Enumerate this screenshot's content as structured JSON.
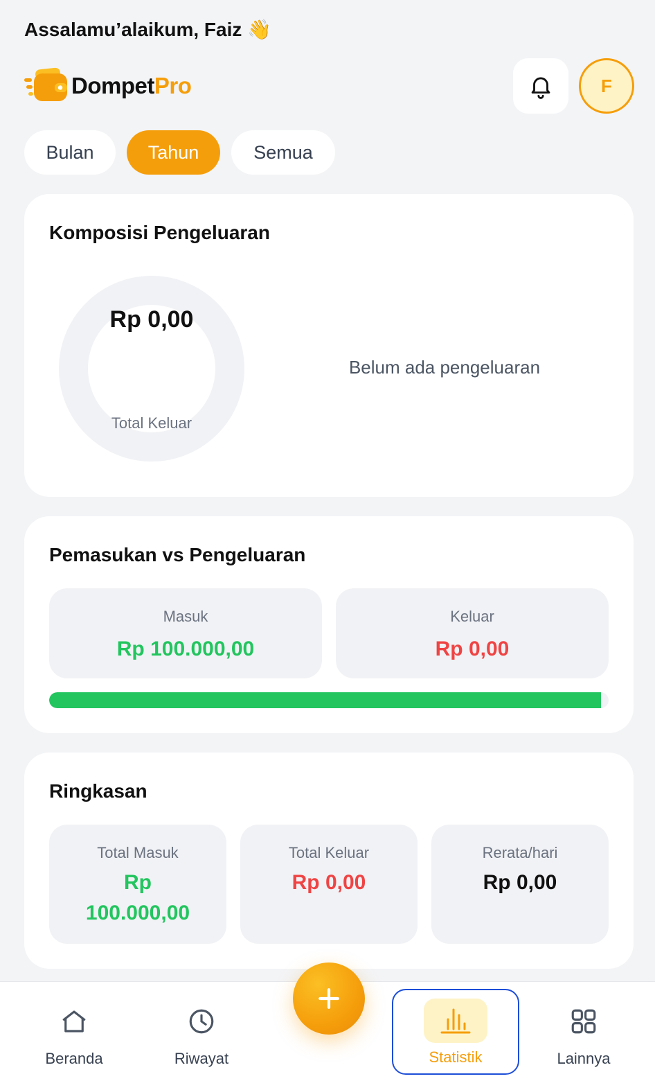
{
  "header": {
    "greeting": "Assalamu’alaikum, Faiz",
    "greeting_emoji": "👋",
    "brand_primary": "Dompet",
    "brand_accent": "Pro",
    "avatar_initial": "F"
  },
  "filters": [
    {
      "label": "Bulan",
      "active": false
    },
    {
      "label": "Tahun",
      "active": true
    },
    {
      "label": "Semua",
      "active": false
    }
  ],
  "composition": {
    "title": "Komposisi Pengeluaran",
    "total_value": "Rp 0,00",
    "total_label": "Total Keluar",
    "empty_message": "Belum ada pengeluaran"
  },
  "income_vs_expense": {
    "title": "Pemasukan vs Pengeluaran",
    "income_label": "Masuk",
    "income_value": "Rp 100.000,00",
    "expense_label": "Keluar",
    "expense_value": "Rp 0,00",
    "income_ratio": 0.987
  },
  "summary": {
    "title": "Ringkasan",
    "total_income_label": "Total Masuk",
    "total_income_value_line1": "Rp",
    "total_income_value_line2": "100.000,00",
    "total_expense_label": "Total Keluar",
    "total_expense_value": "Rp 0,00",
    "daily_avg_label": "Rerata/hari",
    "daily_avg_value": "Rp 0,00"
  },
  "nav": {
    "home": "Beranda",
    "history": "Riwayat",
    "stats": "Statistik",
    "more": "Lainnya",
    "active": "stats"
  },
  "icons": {
    "notification": "bell-icon",
    "add": "plus-icon",
    "home": "home-icon",
    "history": "clock-icon",
    "stats": "bar-chart-icon",
    "more": "grid-icon"
  },
  "colors": {
    "accent": "#f59e0b",
    "income": "#22c55e",
    "expense": "#ef4444",
    "background": "#f3f4f6",
    "active_nav_outline": "#1d4ed8"
  }
}
